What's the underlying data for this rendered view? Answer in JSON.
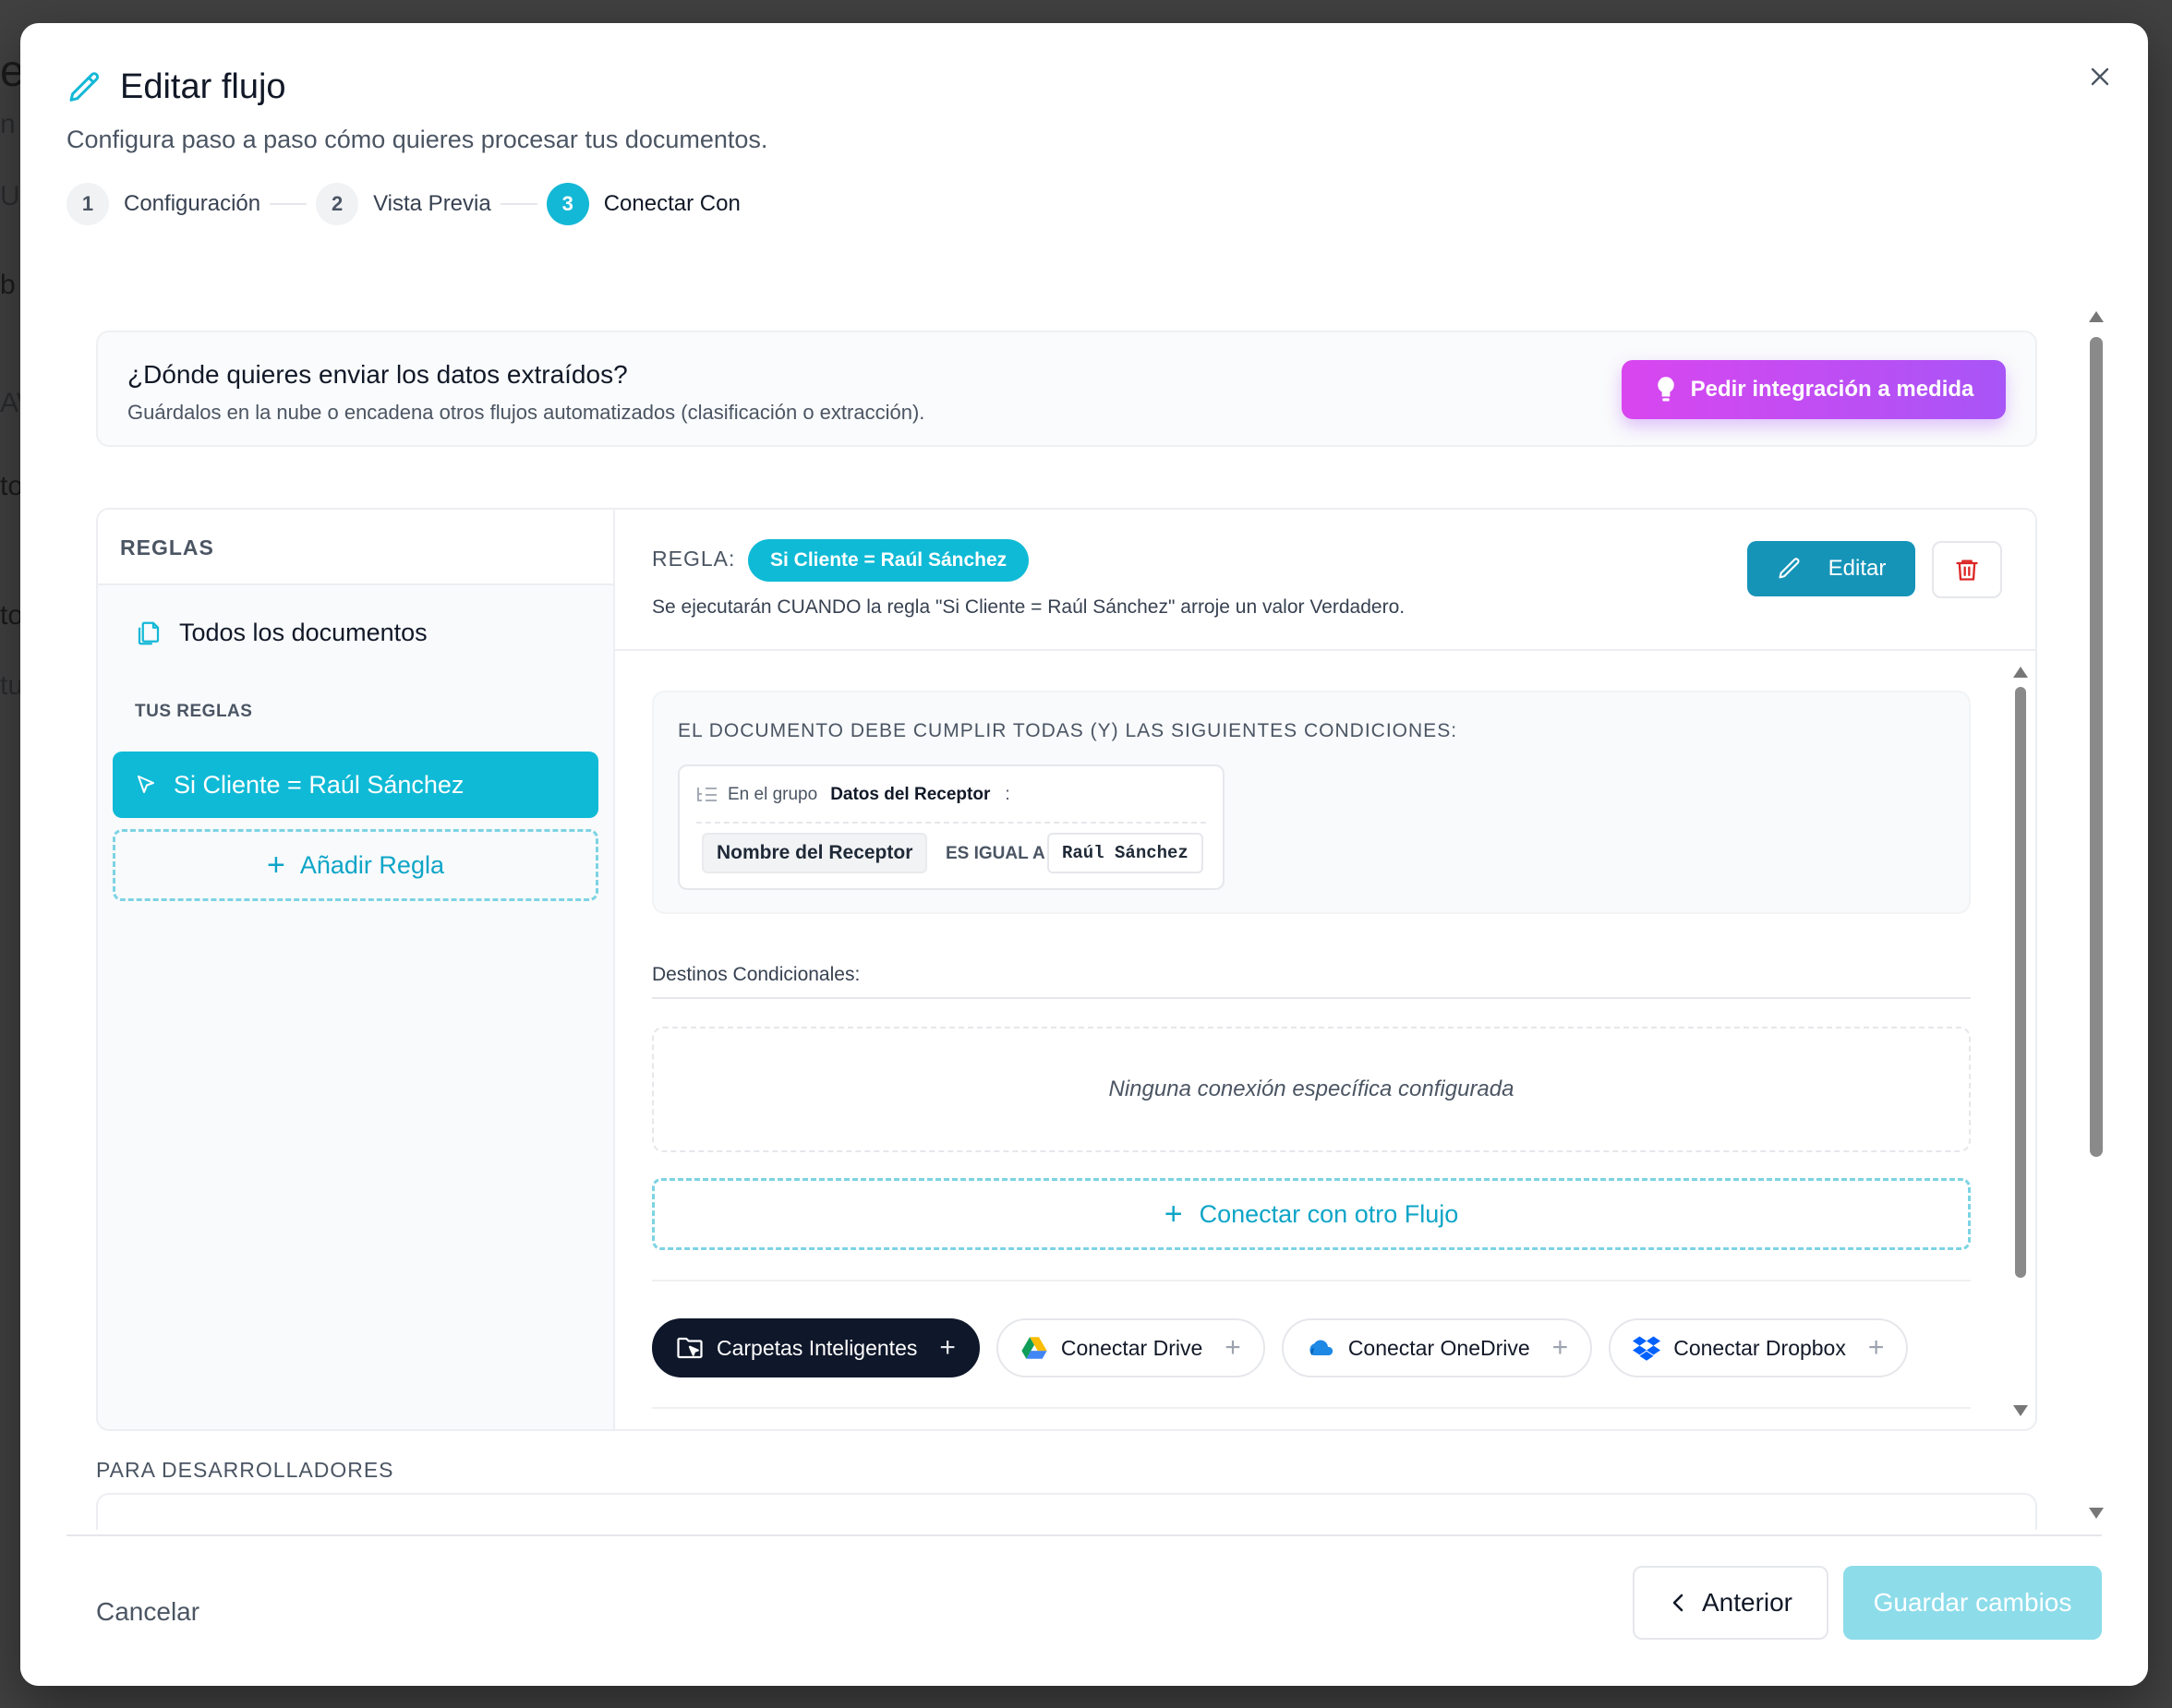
{
  "background": {
    "fragments": [
      "e",
      "n",
      "U",
      "b",
      "AV",
      "to",
      "to",
      "tu"
    ]
  },
  "modal": {
    "title": "Editar flujo",
    "subtitle": "Configura paso a paso cómo quieres procesar tus documentos.",
    "steps": [
      {
        "num": "1",
        "label": "Configuración"
      },
      {
        "num": "2",
        "label": "Vista Previa"
      },
      {
        "num": "3",
        "label": "Conectar Con"
      }
    ],
    "active_step": 3
  },
  "destination": {
    "question": "¿Dónde quieres enviar los datos extraídos?",
    "description": "Guárdalos en la nube o encadena otros flujos automatizados (clasificación o extracción).",
    "custom_button": "Pedir integración a medida"
  },
  "rules": {
    "header": "REGLAS",
    "all_documents": "Todos los documentos",
    "your_rules_label": "TUS REGLAS",
    "items": [
      {
        "label": "Si Cliente = Raúl Sánchez"
      }
    ],
    "add_rule": "Añadir Regla"
  },
  "rule_detail": {
    "label": "REGLA:",
    "pill": "Si Cliente = Raúl Sánchez",
    "description": "Se ejecutarán CUANDO la regla \"Si Cliente = Raúl Sánchez\" arroje un valor Verdadero.",
    "edit_button": "Editar",
    "conditions_title": "EL DOCUMENTO DEBE CUMPLIR TODAS (Y) LAS SIGUIENTES CONDICIONES:",
    "condition": {
      "group_prefix": "En el grupo",
      "group_name": "Datos del Receptor",
      "group_suffix": ":",
      "field": "Nombre del Receptor",
      "operator": "ES IGUAL A",
      "value": "Raúl Sánchez"
    },
    "conditional_destinations_label": "Destinos Condicionales:",
    "no_connection": "Ninguna conexión específica configurada",
    "connect_flow": "Conectar con otro Flujo",
    "connectors": [
      {
        "label": "Carpetas Inteligentes",
        "icon": "smart-folder-icon"
      },
      {
        "label": "Conectar Drive",
        "icon": "google-drive-icon"
      },
      {
        "label": "Conectar OneDrive",
        "icon": "onedrive-icon"
      },
      {
        "label": "Conectar Dropbox",
        "icon": "dropbox-icon"
      }
    ]
  },
  "developers": {
    "label": "PARA DESARROLLADORES"
  },
  "footer": {
    "cancel": "Cancelar",
    "previous": "Anterior",
    "save": "Guardar cambios"
  },
  "colors": {
    "accent": "#0fbad6",
    "edit_button": "#1594b8",
    "magic_gradient_start": "#d946ef",
    "magic_gradient_end": "#a855f7",
    "save_disabled": "#8ddcea",
    "dark_chip": "#0f172a",
    "delete_red": "#dc2626"
  }
}
